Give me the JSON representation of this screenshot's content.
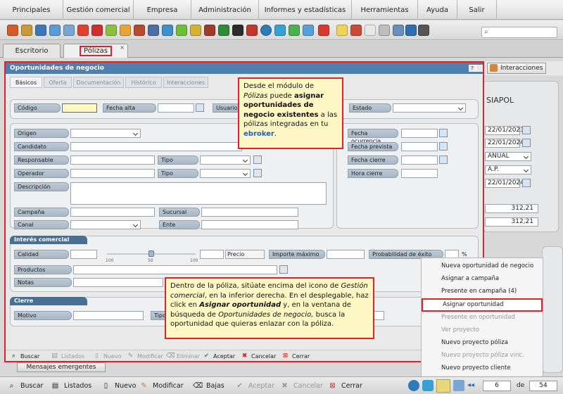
{
  "menu": [
    "Principales",
    "Gestión comercial",
    "Empresa",
    "Administración",
    "Informes y estadísticas",
    "Herramientas",
    "Ayuda",
    "Salir"
  ],
  "tabs": {
    "escritorio": "Escritorio",
    "polizas": "Pólizas",
    "close": "×"
  },
  "interacciones_button": "Interacciones",
  "background": {
    "name_fragment": "SIAPOL",
    "dates": [
      "22/01/2023",
      "22/01/2024"
    ],
    "period": "ANUAL",
    "payment": "A.P.",
    "date3": "22/01/2024",
    "amounts": [
      "312,21",
      "312,21"
    ],
    "mensajes": "Mensajes emergentes"
  },
  "modal": {
    "title": "Oportunidades de negocio",
    "help": "?",
    "subtabs": [
      "Básicos",
      "Oferta",
      "Documentación",
      "Histórico",
      "Interacciones"
    ],
    "labels": {
      "codigo": "Código",
      "fecha_alta": "Fecha alta",
      "usuario": "Usuario",
      "estado": "Estado",
      "origen": "Origen",
      "candidato": "Candidato",
      "responsable": "Responsable",
      "tipo1": "Tipo",
      "operador": "Operador",
      "tipo2": "Tipo",
      "descripcion": "Descripción",
      "campana": "Campaña",
      "sucursal": "Sucursal",
      "canal": "Canal",
      "ente": "Ente",
      "fecha_ocurrencia": "Fecha ocurrencia",
      "fecha_prevista": "Fecha prevista",
      "fecha_cierre": "Fecha cierre",
      "hora_cierre": "Hora cierre",
      "interes_title": "Interés comercial",
      "calidad": "Calidad",
      "precio": "Precio",
      "importe_maximo": "Importe máximo",
      "probabilidad": "Probabilidad de éxito",
      "percent": "%",
      "productos": "Productos",
      "notas": "Notas",
      "cierre_title": "Cierre",
      "motivo": "Motivo",
      "tipo3": "Tipo"
    },
    "slider": {
      "min": "100",
      "mid": "50",
      "max": "100",
      "level": 0.5
    },
    "buttons": [
      "Buscar",
      "Listados",
      "Nuevo",
      "Modificar",
      "Eliminar",
      "Aceptar",
      "Cancelar",
      "Cerrar"
    ]
  },
  "callouts": {
    "top": {
      "p1": "Desde el módulo de ",
      "p2": "Pólizas",
      "p3": " puede ",
      "p4": "asignar oportunidades de negocio existentes",
      "p5": " a las pólizas integradas en tu ",
      "p6": "ebroker",
      "p7": "."
    },
    "bottom": {
      "p1": "Dentro de la póliza, sitúate encima del icono de ",
      "p2": "Gestión comercial",
      "p3": ", en la inferior derecha. En el desplegable, haz click en ",
      "p4": "Asignar oportunidad",
      "p5": " y, en la ventana de búsqueda de ",
      "p6": "Oportunidades de negocio,",
      "p7": " busca la oportunidad que quieras enlazar con la póliza."
    }
  },
  "context_menu": [
    {
      "label": "Nueva oportunidad de negocio",
      "enabled": true
    },
    {
      "label": "Asignar a campaña",
      "enabled": true
    },
    {
      "label": "Presente en campaña (4)",
      "enabled": true
    },
    {
      "label": "Asignar oportunidad",
      "enabled": true,
      "highlighted": true
    },
    {
      "label": "Presente en oportunidad",
      "enabled": false
    },
    {
      "label": "Ver proyecto",
      "enabled": false
    },
    {
      "label": "Nuevo proyecto póliza",
      "enabled": true
    },
    {
      "label": "Nuevo proyecto póliza vinc.",
      "enabled": false
    },
    {
      "label": "Nuevo proyecto cliente",
      "enabled": true
    }
  ],
  "statusbar": {
    "buttons": [
      "Buscar",
      "Listados",
      "Nuevo",
      "Modificar",
      "Bajas",
      "Aceptar",
      "Cancelar",
      "Cerrar"
    ],
    "page": "6",
    "de": "de",
    "total": "54"
  },
  "colors": {
    "accent": "#4e7fae",
    "highlight": "#e0222b",
    "callout_bg": "#fff7c4",
    "brand": "#1f5fb8"
  }
}
